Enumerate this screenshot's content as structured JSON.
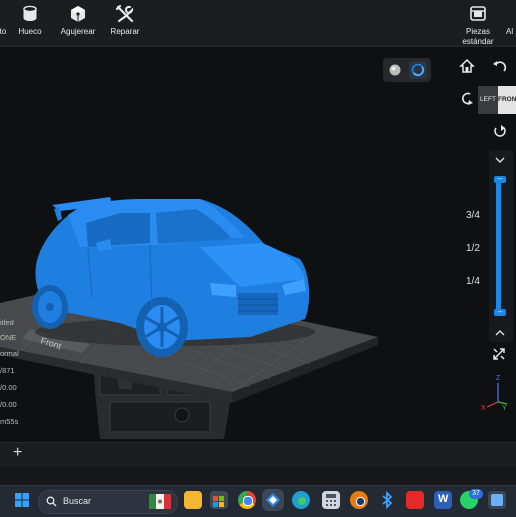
{
  "toolbar": {
    "items": [
      {
        "label": "to"
      },
      {
        "label": "Hueco"
      },
      {
        "label": "Agujerear"
      },
      {
        "label": "Reparar"
      },
      {
        "label": "Piezas"
      },
      {
        "label": "estándar"
      },
      {
        "label": "Al"
      }
    ]
  },
  "viewport": {
    "bed_label": "Front",
    "view_cube": {
      "left": "LEFT",
      "front": "FRONT"
    },
    "layer_fractions": [
      "3/4",
      "1/2",
      "1/4"
    ]
  },
  "info_panel": {
    "lines": [
      "itled",
      "ONE",
      "ormal",
      "/871",
      "/0.00",
      "/0.00",
      "m55s"
    ]
  },
  "statusbar": {
    "add_label": "+"
  },
  "taskbar": {
    "search_placeholder": "Buscar",
    "whatsapp_badge": "37"
  },
  "colors": {
    "model": "#1f7fe0",
    "accent": "#1a86e6",
    "bed": "#3c3d40",
    "toolbar": "#1c1d1f"
  }
}
